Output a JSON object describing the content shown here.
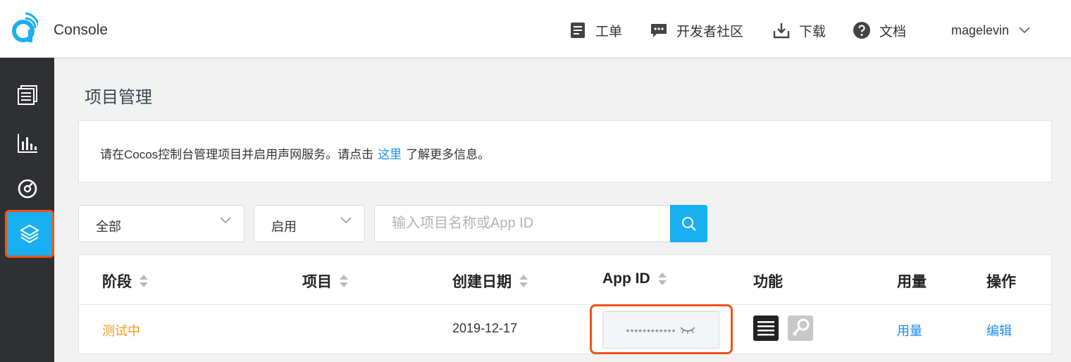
{
  "header": {
    "brand": "Console",
    "nav": [
      {
        "label": "工单",
        "icon": "ticket-icon"
      },
      {
        "label": "开发者社区",
        "icon": "community-icon"
      },
      {
        "label": "下载",
        "icon": "download-icon"
      },
      {
        "label": "文档",
        "icon": "help-icon"
      }
    ],
    "user": "magelevin"
  },
  "sidebar": {
    "items": [
      {
        "icon": "list-icon",
        "active": false
      },
      {
        "icon": "bar-chart-icon",
        "active": false
      },
      {
        "icon": "gauge-icon",
        "active": false
      },
      {
        "icon": "layers-icon",
        "active": true
      }
    ]
  },
  "main": {
    "title": "项目管理",
    "notice": {
      "before": "请在Cocos控制台管理项目并启用声网服务。请点击",
      "link": "这里",
      "after": "了解更多信息。"
    },
    "filters": {
      "stage_value": "全部",
      "status_value": "启用",
      "search_placeholder": "输入项目名称或App ID"
    },
    "table": {
      "columns": [
        "阶段",
        "项目",
        "创建日期",
        "App ID",
        "功能",
        "用量",
        "操作"
      ],
      "rows": [
        {
          "stage": "测试中",
          "project": "",
          "created": "2019-12-17",
          "app_id": "••••••••••••",
          "usage_link": "用量",
          "action_link": "编辑"
        }
      ]
    }
  },
  "colors": {
    "accent": "#18b0f0",
    "highlight": "#f0531a",
    "stage": "#f39b19",
    "link": "#1a8cf0",
    "sidebar": "#2f3033"
  }
}
